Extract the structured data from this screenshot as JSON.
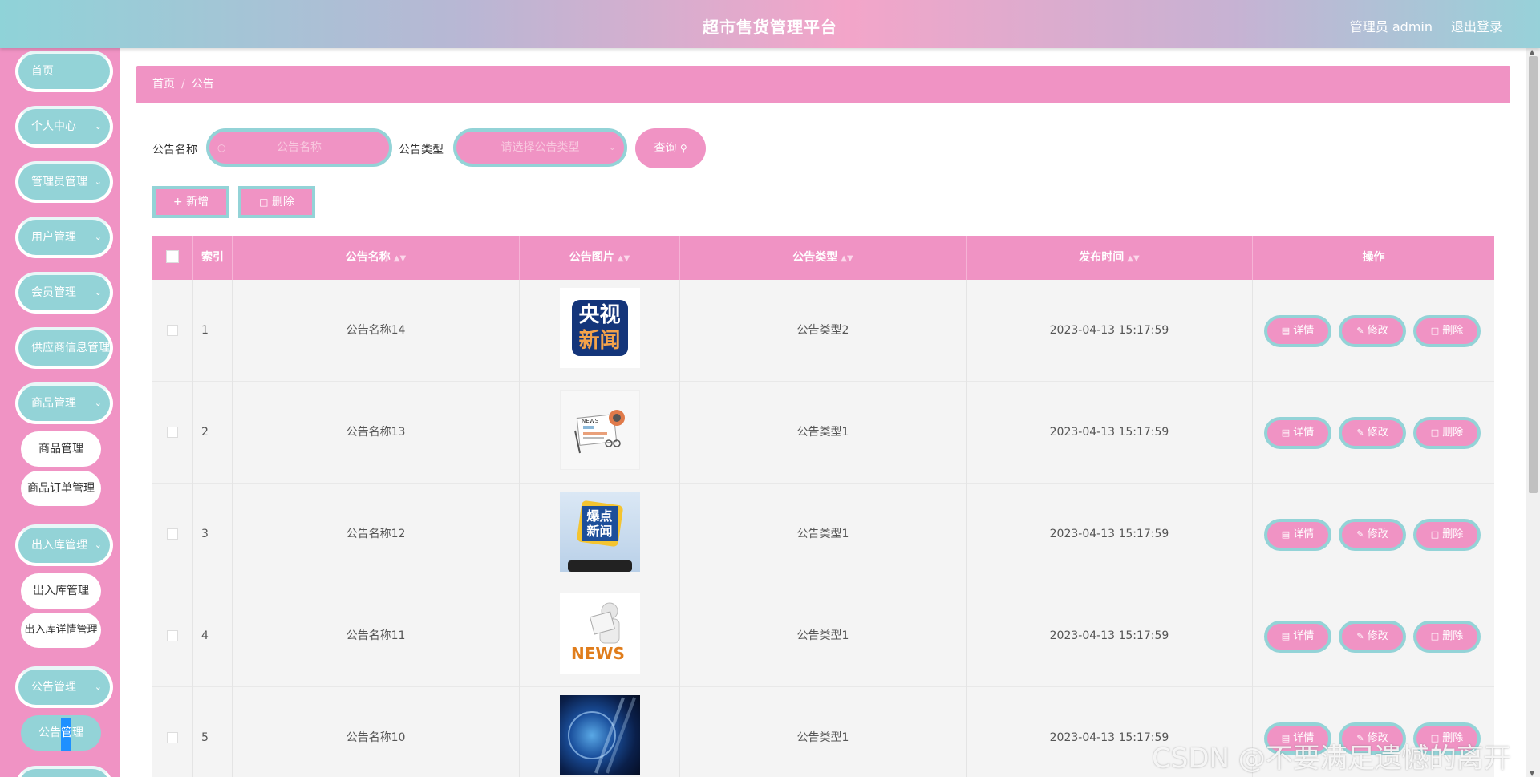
{
  "header": {
    "title": "超市售货管理平台",
    "user_label": "管理员 admin",
    "logout_label": "退出登录"
  },
  "sidebar": {
    "items": [
      {
        "label": "首页",
        "has_chevron": false
      },
      {
        "label": "个人中心",
        "has_chevron": true
      },
      {
        "label": "管理员管理",
        "has_chevron": true
      },
      {
        "label": "用户管理",
        "has_chevron": true
      },
      {
        "label": "会员管理",
        "has_chevron": true
      },
      {
        "label": "供应商信息管理",
        "has_chevron": false
      },
      {
        "label": "商品管理",
        "has_chevron": true
      },
      {
        "label": "商品管理",
        "sub": true
      },
      {
        "label": "商品订单管理",
        "sub": true
      },
      {
        "label": "出入库管理",
        "has_chevron": true
      },
      {
        "label": "出入库管理",
        "sub": true
      },
      {
        "label": "出入库详情管理",
        "sub": true
      },
      {
        "label": "公告管理",
        "has_chevron": true
      },
      {
        "label": "公告管理",
        "sub": true,
        "active": true
      }
    ]
  },
  "breadcrumb": {
    "home": "首页",
    "separator": "/",
    "current": "公告"
  },
  "search": {
    "name_label": "公告名称",
    "name_placeholder": "公告名称",
    "type_label": "公告类型",
    "type_placeholder": "请选择公告类型",
    "query_label": "查询"
  },
  "actions": {
    "add_label": "新增",
    "delete_label": "删除"
  },
  "table": {
    "columns": [
      "索引",
      "公告名称",
      "公告图片",
      "公告类型",
      "发布时间",
      "操作"
    ],
    "rows": [
      {
        "index": "1",
        "name": "公告名称14",
        "image": "cctv-news",
        "type": "公告类型2",
        "time": "2023-04-13 15:17:59"
      },
      {
        "index": "2",
        "name": "公告名称13",
        "image": "newspaper",
        "type": "公告类型1",
        "time": "2023-04-13 15:17:59"
      },
      {
        "index": "3",
        "name": "公告名称12",
        "image": "breaking-news",
        "type": "公告类型1",
        "time": "2023-04-13 15:17:59"
      },
      {
        "index": "4",
        "name": "公告名称11",
        "image": "news-figure",
        "type": "公告类型1",
        "time": "2023-04-13 15:17:59"
      },
      {
        "index": "5",
        "name": "公告名称10",
        "image": "globe",
        "type": "公告类型1",
        "time": "2023-04-13 15:17:59"
      }
    ],
    "row_actions": {
      "detail": "详情",
      "edit": "修改",
      "delete": "删除"
    },
    "cctv_text_top": "央视",
    "cctv_text_bottom": "新闻",
    "breaking_text_top": "爆点",
    "breaking_text_bottom": "新闻",
    "news_word": "NEWS"
  },
  "watermark": "CSDN @不要满足遗憾的离开",
  "colors": {
    "pink": "#f093c4",
    "teal": "#93d3d7"
  }
}
